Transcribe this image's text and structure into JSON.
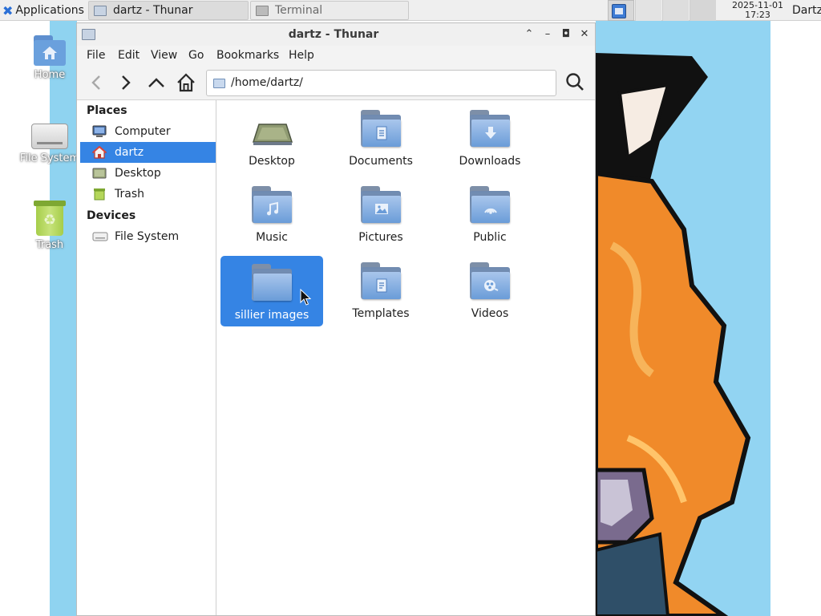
{
  "panel": {
    "apps_label": "Applications",
    "tasks": [
      {
        "label": "dartz - Thunar"
      },
      {
        "label": "Terminal"
      }
    ],
    "clock_date": "2025-11-01",
    "clock_time": "17:23",
    "user": "Dartz"
  },
  "desktop_icons": [
    {
      "label": "Home",
      "icon": "home-folder-icon"
    },
    {
      "label": "File System",
      "icon": "hard-drive-icon"
    },
    {
      "label": "Trash",
      "icon": "trash-icon"
    }
  ],
  "window": {
    "title": "dartz - Thunar",
    "menus": [
      "File",
      "Edit",
      "View",
      "Go",
      "Bookmarks",
      "Help"
    ],
    "location": "/home/dartz/"
  },
  "sidebar": {
    "places_header": "Places",
    "places": [
      {
        "label": "Computer",
        "icon": "computer-icon"
      },
      {
        "label": "dartz",
        "icon": "home-icon",
        "selected": true
      },
      {
        "label": "Desktop",
        "icon": "desktop-icon"
      },
      {
        "label": "Trash",
        "icon": "trash-icon"
      }
    ],
    "devices_header": "Devices",
    "devices": [
      {
        "label": "File System",
        "icon": "drive-icon"
      }
    ]
  },
  "files": [
    {
      "label": "Desktop",
      "icon": "desktop-folder-icon"
    },
    {
      "label": "Documents",
      "icon": "documents-folder-icon"
    },
    {
      "label": "Downloads",
      "icon": "downloads-folder-icon"
    },
    {
      "label": "Music",
      "icon": "music-folder-icon"
    },
    {
      "label": "Pictures",
      "icon": "pictures-folder-icon"
    },
    {
      "label": "Public",
      "icon": "public-folder-icon"
    },
    {
      "label": "sillier images",
      "icon": "folder-icon",
      "selected": true
    },
    {
      "label": "Templates",
      "icon": "templates-folder-icon"
    },
    {
      "label": "Videos",
      "icon": "videos-folder-icon"
    }
  ],
  "colors": {
    "selection": "#3584e4",
    "desktop_sky": "#8fd3f0",
    "folder_blue": "#6a9cd8"
  }
}
